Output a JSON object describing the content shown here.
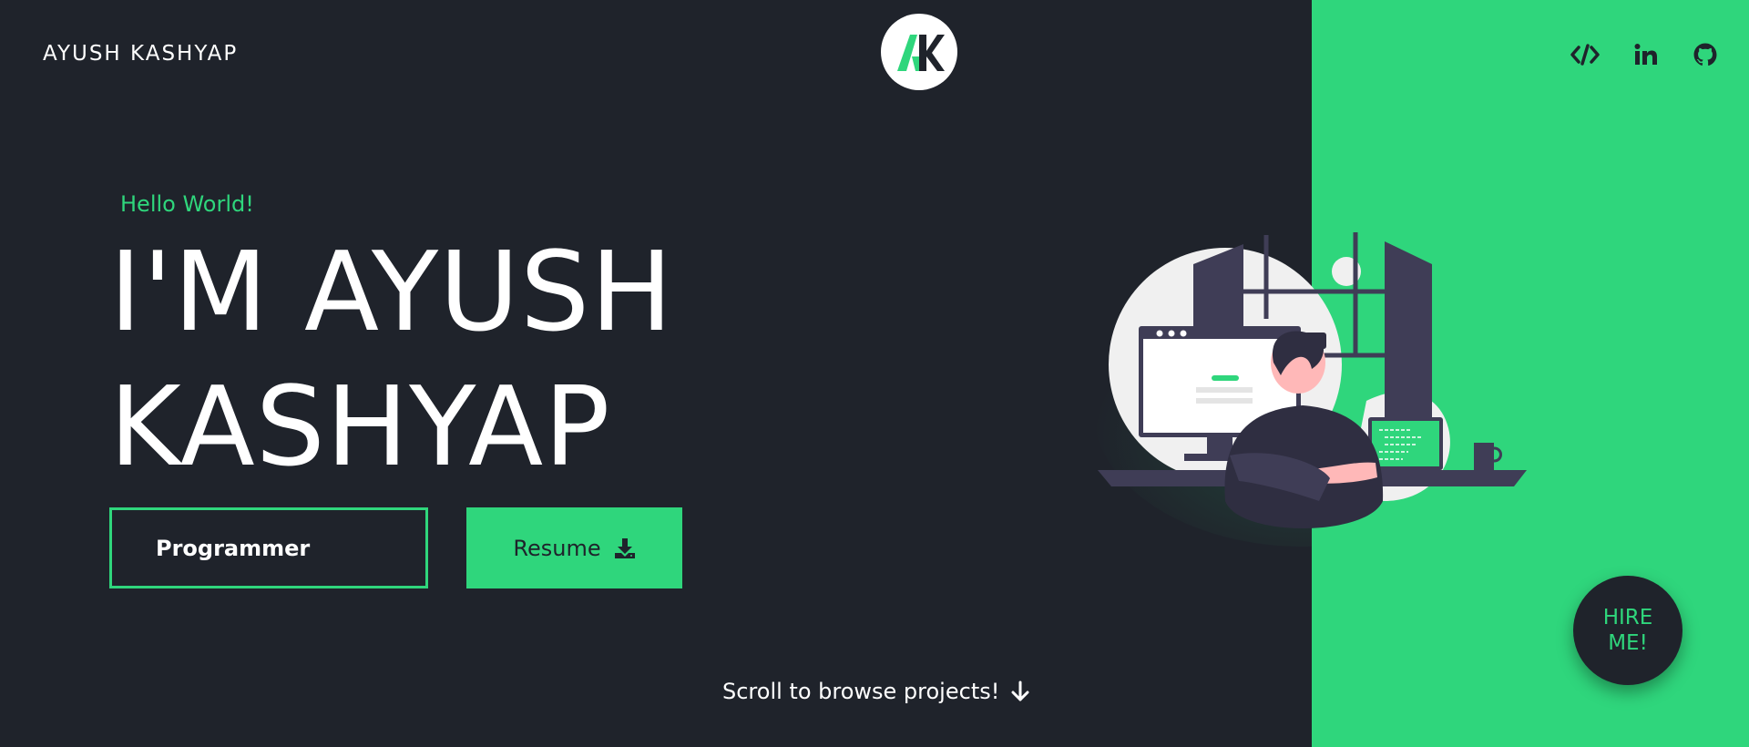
{
  "header": {
    "brand": "AYUSH KASHYAP",
    "logo_text": "AK",
    "social": [
      {
        "name": "code-icon"
      },
      {
        "name": "linkedin-icon",
        "label": "in"
      },
      {
        "name": "github-icon"
      }
    ]
  },
  "hero": {
    "greeting": "Hello World!",
    "title_line1": "I'M AYUSH",
    "title_line2": "KASHYAP",
    "role": "Programmer",
    "resume_label": "Resume"
  },
  "scroll_hint": "Scroll to browse projects!",
  "hire_label": "HIRE ME!",
  "colors": {
    "background": "#1f232b",
    "accent": "#2fd67c",
    "text": "#ffffff"
  }
}
